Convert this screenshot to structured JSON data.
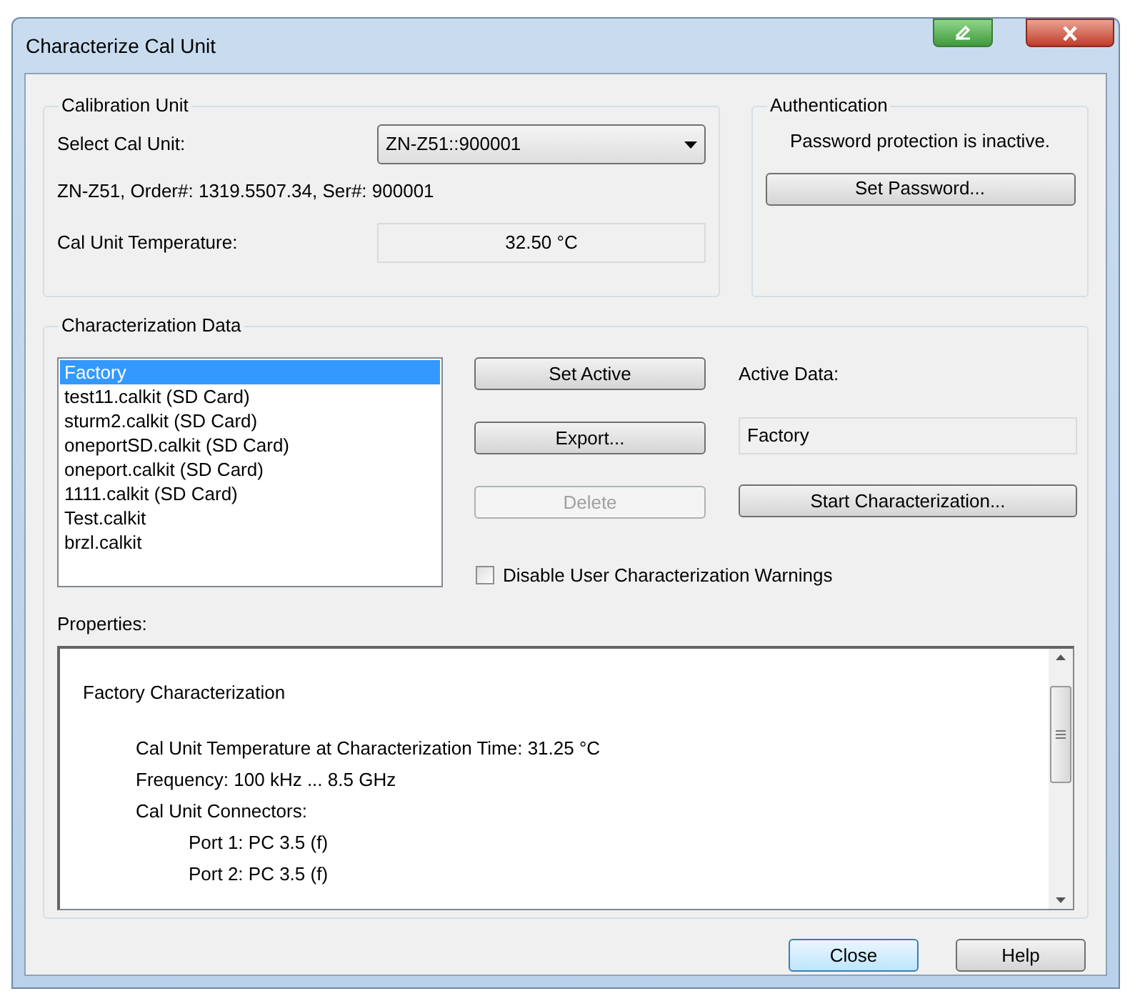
{
  "window": {
    "title": "Characterize Cal Unit"
  },
  "calibration_unit": {
    "title": "Calibration Unit",
    "select_label": "Select Cal Unit:",
    "select_value": "ZN-Z51::900001",
    "info": "ZN-Z51, Order#: 1319.5507.34, Ser#: 900001",
    "temperature_label": "Cal Unit Temperature:",
    "temperature_value": "32.50 °C"
  },
  "authentication": {
    "title": "Authentication",
    "status": "Password protection is inactive.",
    "button": "Set Password..."
  },
  "characterization_data": {
    "title": "Characterization Data",
    "items": [
      {
        "label": "Factory",
        "selected": true
      },
      {
        "label": "test11.calkit (SD Card)",
        "selected": false
      },
      {
        "label": "sturm2.calkit (SD Card)",
        "selected": false
      },
      {
        "label": "oneportSD.calkit (SD Card)",
        "selected": false
      },
      {
        "label": "oneport.calkit (SD Card)",
        "selected": false
      },
      {
        "label": "1111.calkit (SD Card)",
        "selected": false
      },
      {
        "label": "Test.calkit",
        "selected": false
      },
      {
        "label": "brzl.calkit",
        "selected": false
      }
    ],
    "buttons": [
      {
        "label": "Set Active",
        "disabled": false
      },
      {
        "label": "Export...",
        "disabled": false
      },
      {
        "label": "Delete",
        "disabled": true
      }
    ],
    "active_data_label": "Active Data:",
    "active_data_value": "Factory",
    "start_button": "Start Characterization...",
    "checkbox": {
      "label": "Disable User Characterization Warnings",
      "checked": false
    },
    "properties_label": "Properties:",
    "properties": [
      {
        "text": "Factory Characterization",
        "children": [
          {
            "text": "Cal Unit Temperature at Characterization Time: 31.25 °C"
          },
          {
            "text": "Frequency: 100 kHz ... 8.5 GHz"
          },
          {
            "text": "Cal Unit Connectors:",
            "children": [
              {
                "text": "Port 1: PC 3.5 (f)"
              },
              {
                "text": "Port 2: PC 3.5 (f)"
              }
            ]
          }
        ]
      }
    ]
  },
  "footer_buttons": [
    {
      "label": "Close",
      "selected": true
    },
    {
      "label": "Help",
      "selected": false
    }
  ]
}
